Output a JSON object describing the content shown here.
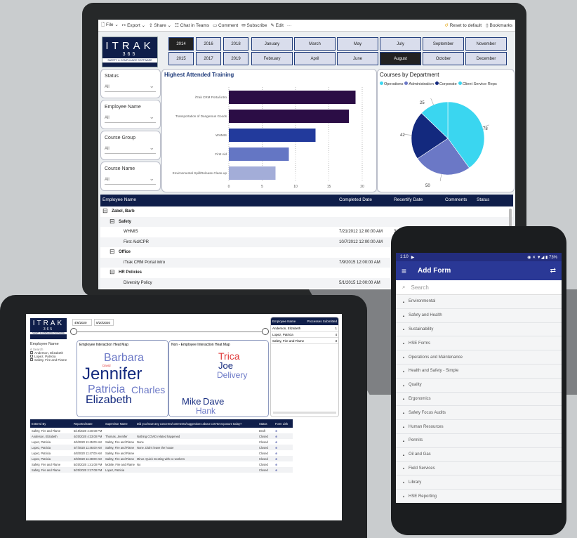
{
  "laptop": {
    "toolbar": {
      "file": "File",
      "export": "Export",
      "share": "Share",
      "chat": "Chat in Teams",
      "comment": "Comment",
      "subscribe": "Subscribe",
      "edit": "Edit",
      "more": "···",
      "reset": "Reset to default",
      "bookmarks": "Bookmarks"
    },
    "logo": {
      "line1": "ITRAK",
      "line2": "365",
      "line3": "SAFETY & COMPLIANCE SOFTWARE"
    },
    "years": [
      "2014",
      "2016",
      "2018",
      "2015",
      "2017",
      "2019"
    ],
    "selected_year": "2014",
    "months": [
      "January",
      "March",
      "May",
      "July",
      "September",
      "November",
      "February",
      "April",
      "June",
      "August",
      "October",
      "December"
    ],
    "selected_month": "August",
    "filters": [
      {
        "label": "Status",
        "value": "All"
      },
      {
        "label": "Employee Name",
        "value": "All"
      },
      {
        "label": "Course Group",
        "value": "All"
      },
      {
        "label": "Course Name",
        "value": "All"
      }
    ],
    "table": {
      "headers": [
        "Employee Name",
        "Completed Date",
        "Recertify Date",
        "Comments",
        "Status"
      ],
      "rows": [
        {
          "level": 0,
          "text": "Zabel, Barb",
          "completed": "",
          "recertify": ""
        },
        {
          "level": 1,
          "text": "Safety",
          "completed": "",
          "recertify": ""
        },
        {
          "level": 2,
          "text": "WHMIS",
          "completed": "7/21/2012 12:00:00 AM",
          "recertify": "3/24/2015 12:00"
        },
        {
          "level": 2,
          "text": "First Aid/CPR",
          "completed": "10/7/2012 12:00:00 AM",
          "recertify": ""
        },
        {
          "level": 1,
          "text": "Office",
          "completed": "",
          "recertify": ""
        },
        {
          "level": 2,
          "text": "iTrak CRM Portal intro",
          "completed": "7/9/2015 12:00:00 AM",
          "recertify": ""
        },
        {
          "level": 1,
          "text": "HR Policies",
          "completed": "",
          "recertify": ""
        },
        {
          "level": 2,
          "text": "Diversity Policy",
          "completed": "5/1/2015 12:00:00 AM",
          "recertify": ""
        }
      ]
    }
  },
  "chart_data": [
    {
      "type": "bar",
      "title": "Highest Attended Training",
      "categories": [
        "iTrak CRM Portal intro",
        "Transportation of Dangerous Goods",
        "WHMIS",
        "First Aid",
        "Environmental Spill/Release Clean-up"
      ],
      "values": [
        19,
        18,
        13,
        9,
        7
      ],
      "colors": [
        "#2b0d45",
        "#2b0d45",
        "#223a9c",
        "#6476c4",
        "#a3add8"
      ],
      "xticks": [
        "0",
        "5",
        "10",
        "15",
        "20"
      ],
      "xlim": [
        0,
        20
      ]
    },
    {
      "type": "pie",
      "title": "Courses by Department",
      "legend": [
        "Operations",
        "Administration",
        "Corporate",
        "Client Service Reps"
      ],
      "legend_colors": [
        "#3dd8f2",
        "#6b78c6",
        "#13297e",
        "#3ad6f0"
      ],
      "values": [
        78,
        50,
        42,
        25
      ],
      "labels": [
        "78",
        "50",
        "42",
        "25"
      ],
      "colors": [
        "#3ad6f0",
        "#6b78c6",
        "#13297e",
        "#3ad6f0"
      ]
    }
  ],
  "tablet": {
    "logo": {
      "line1": "ITRAK",
      "line2": "365",
      "line3": "SAFETY & COMPLIANCE SOFTWARE"
    },
    "date_from": "4/6/2020",
    "date_to": "5/20/2020",
    "employee_filter": {
      "title": "Employee Name",
      "search": "Search",
      "options": [
        "Anderson, Elizabeth",
        "Lopez, Patricia",
        "Safety, Fire and Flame"
      ]
    },
    "heat1": {
      "title": "Employee Interaction Heat Map",
      "words": [
        "Barbara",
        "David",
        "Jennifer",
        "Patricia",
        "Charles",
        "Elizabeth"
      ]
    },
    "heat2": {
      "title": "Non - Employee Interaction Heat Map",
      "words": [
        "Trica",
        "Joe",
        "Delivery",
        "Mike",
        "Dave",
        "Hank"
      ]
    },
    "summary": {
      "headers": [
        "Employee Name",
        "Processes Submitted"
      ],
      "rows": [
        [
          "Anderson, Elizabeth",
          "1"
        ],
        [
          "Lopez, Patricia",
          "4"
        ],
        [
          "Safety, Fire and Flame",
          "3"
        ]
      ]
    },
    "table": {
      "headers": [
        "Entered By",
        "Reported Date",
        "Supervisor Name",
        "Did you have any concerns/comments/suggestions about COVID exposure today?",
        "Status",
        "Form Link"
      ],
      "rows": [
        [
          "Safety, Fire and Flame",
          "5/19/2020 4:40:00 PM",
          "",
          "",
          "Draft",
          "⊕"
        ],
        [
          "Anderson, Elizabeth",
          "4/20/2020 4:33:00 PM",
          "Thomas, Jennifer",
          "Nothing COVID related happened",
          "Closed",
          "⊕"
        ],
        [
          "Lopez, Patricia",
          "4/6/2020 11:45:00 AM",
          "Safety, Fire and Flame",
          "None",
          "Closed",
          "⊕"
        ],
        [
          "Lopez, Patricia",
          "4/7/2020 11:46:00 AM",
          "Safety, Fire and Flame",
          "None. Didn't leave the house",
          "Closed",
          "⊕"
        ],
        [
          "Lopez, Patricia",
          "4/8/2020 11:47:00 AM",
          "Safety, Fire and Flame",
          "",
          "Closed",
          "⊕"
        ],
        [
          "Lopez, Patricia",
          "4/9/2020 11:48:00 AM",
          "Safety, Fire and Flame",
          "Minor. Quick meeting with co-workers",
          "Closed",
          "⊕"
        ],
        [
          "Safety, Fire and Flame",
          "5/20/2020 1:41:00 PM",
          "Mobile, Fire and Flame",
          "No",
          "Closed",
          "⊕"
        ],
        [
          "Safety, Fire and Flame",
          "5/20/2020 2:17:00 PM",
          "Lopez, Patricia",
          "",
          "Closed",
          "⊕"
        ]
      ]
    }
  },
  "phone": {
    "status_time": "1:10",
    "battery": "73%",
    "title": "Add Form",
    "search_placeholder": "Search",
    "items": [
      "Environmental",
      "Safety and Health",
      "Sustainability",
      "HSE Forms",
      "Operations and Maintenance",
      "Health and Safety - Simple",
      "Quality",
      "Ergonomics",
      "Safety Focus Audits",
      "Human Resources",
      "Permits",
      "Oil and Gas",
      "Field Services",
      "Library",
      "HSE Reporting",
      "Support Request"
    ],
    "colors": {
      "appbar": "#2a3896",
      "statusbar": "#232d7e"
    }
  }
}
